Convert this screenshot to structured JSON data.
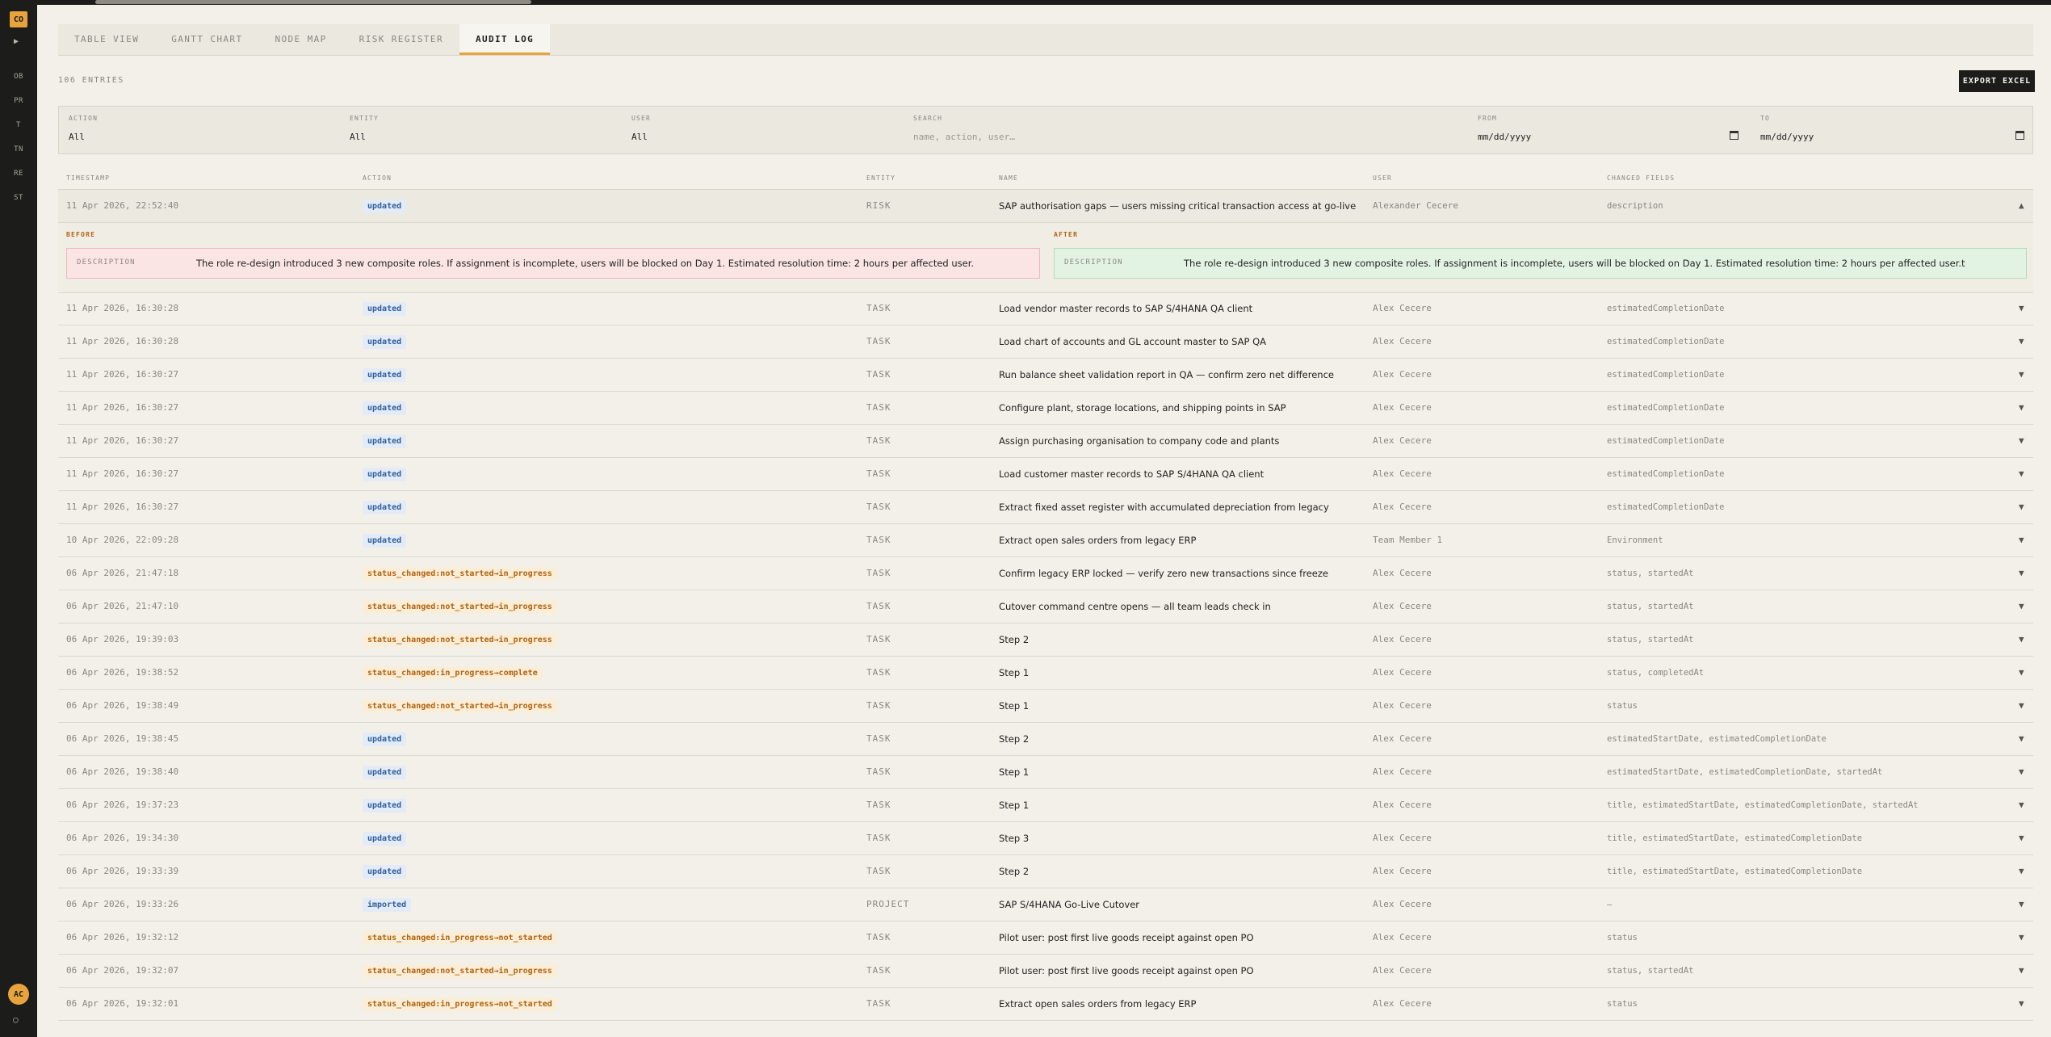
{
  "sidebar": {
    "logo": "CO",
    "items": [
      "OB",
      "PR",
      "T",
      "TN",
      "RE",
      "ST"
    ],
    "avatar": "AC"
  },
  "tabs": [
    "TABLE VIEW",
    "GANTT CHART",
    "NODE MAP",
    "RISK REGISTER",
    "AUDIT LOG"
  ],
  "active_tab": "AUDIT LOG",
  "entries_count": "106 ENTRIES",
  "export_label": "EXPORT EXCEL",
  "filters": {
    "action": {
      "label": "ACTION",
      "value": "All"
    },
    "entity": {
      "label": "ENTITY",
      "value": "All"
    },
    "user": {
      "label": "USER",
      "value": "All"
    },
    "search": {
      "label": "SEARCH",
      "placeholder": "name, action, user…"
    },
    "from": {
      "label": "FROM",
      "placeholder": "mm/dd/yyyy"
    },
    "to": {
      "label": "TO",
      "placeholder": "mm/dd/yyyy"
    }
  },
  "columns": [
    "TIMESTAMP",
    "ACTION",
    "ENTITY",
    "NAME",
    "USER",
    "CHANGED FIELDS"
  ],
  "expanded_row": {
    "timestamp": "11 Apr 2026, 22:52:40",
    "action": "updated",
    "entity": "RISK",
    "name": "SAP authorisation gaps — users missing critical transaction access at go-live",
    "user": "Alexander Cecere",
    "fields": "description",
    "before_title": "BEFORE",
    "after_title": "AFTER",
    "field_label": "DESCRIPTION",
    "before_text": "The role re-design introduced 3 new composite roles. If assignment is incomplete, users will be blocked on Day 1. Estimated resolution time: 2 hours per affected user.",
    "after_text": "The role re-design introduced 3 new composite roles. If assignment is incomplete, users will be blocked on Day 1. Estimated resolution time: 2 hours per affected user.t",
    "chevron": "▲"
  },
  "rows": [
    {
      "timestamp": "11 Apr 2026, 16:30:28",
      "action": "updated",
      "kind": "updated",
      "entity": "TASK",
      "name": "Load vendor master records to SAP S/4HANA QA client",
      "user": "Alex Cecere",
      "fields": "estimatedCompletionDate"
    },
    {
      "timestamp": "11 Apr 2026, 16:30:28",
      "action": "updated",
      "kind": "updated",
      "entity": "TASK",
      "name": "Load chart of accounts and GL account master to SAP QA",
      "user": "Alex Cecere",
      "fields": "estimatedCompletionDate"
    },
    {
      "timestamp": "11 Apr 2026, 16:30:27",
      "action": "updated",
      "kind": "updated",
      "entity": "TASK",
      "name": "Run balance sheet validation report in QA — confirm zero net difference",
      "user": "Alex Cecere",
      "fields": "estimatedCompletionDate"
    },
    {
      "timestamp": "11 Apr 2026, 16:30:27",
      "action": "updated",
      "kind": "updated",
      "entity": "TASK",
      "name": "Configure plant, storage locations, and shipping points in SAP",
      "user": "Alex Cecere",
      "fields": "estimatedCompletionDate"
    },
    {
      "timestamp": "11 Apr 2026, 16:30:27",
      "action": "updated",
      "kind": "updated",
      "entity": "TASK",
      "name": "Assign purchasing organisation to company code and plants",
      "user": "Alex Cecere",
      "fields": "estimatedCompletionDate"
    },
    {
      "timestamp": "11 Apr 2026, 16:30:27",
      "action": "updated",
      "kind": "updated",
      "entity": "TASK",
      "name": "Load customer master records to SAP S/4HANA QA client",
      "user": "Alex Cecere",
      "fields": "estimatedCompletionDate"
    },
    {
      "timestamp": "11 Apr 2026, 16:30:27",
      "action": "updated",
      "kind": "updated",
      "entity": "TASK",
      "name": "Extract fixed asset register with accumulated depreciation from legacy",
      "user": "Alex Cecere",
      "fields": "estimatedCompletionDate"
    },
    {
      "timestamp": "10 Apr 2026, 22:09:28",
      "action": "updated",
      "kind": "updated",
      "entity": "TASK",
      "name": "Extract open sales orders from legacy ERP",
      "user": "Team Member 1",
      "fields": "Environment"
    },
    {
      "timestamp": "06 Apr 2026, 21:47:18",
      "action": "status_changed:not_started→in_progress",
      "kind": "status",
      "entity": "TASK",
      "name": "Confirm legacy ERP locked — verify zero new transactions since freeze",
      "user": "Alex Cecere",
      "fields": "status, startedAt"
    },
    {
      "timestamp": "06 Apr 2026, 21:47:10",
      "action": "status_changed:not_started→in_progress",
      "kind": "status",
      "entity": "TASK",
      "name": "Cutover command centre opens — all team leads check in",
      "user": "Alex Cecere",
      "fields": "status, startedAt"
    },
    {
      "timestamp": "06 Apr 2026, 19:39:03",
      "action": "status_changed:not_started→in_progress",
      "kind": "status",
      "entity": "TASK",
      "name": "Step 2",
      "user": "Alex Cecere",
      "fields": "status, startedAt"
    },
    {
      "timestamp": "06 Apr 2026, 19:38:52",
      "action": "status_changed:in_progress→complete",
      "kind": "status",
      "entity": "TASK",
      "name": "Step 1",
      "user": "Alex Cecere",
      "fields": "status, completedAt"
    },
    {
      "timestamp": "06 Apr 2026, 19:38:49",
      "action": "status_changed:not_started→in_progress",
      "kind": "status",
      "entity": "TASK",
      "name": "Step 1",
      "user": "Alex Cecere",
      "fields": "status"
    },
    {
      "timestamp": "06 Apr 2026, 19:38:45",
      "action": "updated",
      "kind": "updated",
      "entity": "TASK",
      "name": "Step 2",
      "user": "Alex Cecere",
      "fields": "estimatedStartDate, estimatedCompletionDate"
    },
    {
      "timestamp": "06 Apr 2026, 19:38:40",
      "action": "updated",
      "kind": "updated",
      "entity": "TASK",
      "name": "Step 1",
      "user": "Alex Cecere",
      "fields": "estimatedStartDate, estimatedCompletionDate, startedAt"
    },
    {
      "timestamp": "06 Apr 2026, 19:37:23",
      "action": "updated",
      "kind": "updated",
      "entity": "TASK",
      "name": "Step 1",
      "user": "Alex Cecere",
      "fields": "title, estimatedStartDate, estimatedCompletionDate, startedAt"
    },
    {
      "timestamp": "06 Apr 2026, 19:34:30",
      "action": "updated",
      "kind": "updated",
      "entity": "TASK",
      "name": "Step 3",
      "user": "Alex Cecere",
      "fields": "title, estimatedStartDate, estimatedCompletionDate"
    },
    {
      "timestamp": "06 Apr 2026, 19:33:39",
      "action": "updated",
      "kind": "updated",
      "entity": "TASK",
      "name": "Step 2",
      "user": "Alex Cecere",
      "fields": "title, estimatedStartDate, estimatedCompletionDate"
    },
    {
      "timestamp": "06 Apr 2026, 19:33:26",
      "action": "imported",
      "kind": "imported",
      "entity": "PROJECT",
      "name": "SAP S/4HANA Go-Live Cutover",
      "user": "Alex Cecere",
      "fields": "—"
    },
    {
      "timestamp": "06 Apr 2026, 19:32:12",
      "action": "status_changed:in_progress→not_started",
      "kind": "status",
      "entity": "TASK",
      "name": "Pilot user: post first live goods receipt against open PO",
      "user": "Alex Cecere",
      "fields": "status"
    },
    {
      "timestamp": "06 Apr 2026, 19:32:07",
      "action": "status_changed:not_started→in_progress",
      "kind": "status",
      "entity": "TASK",
      "name": "Pilot user: post first live goods receipt against open PO",
      "user": "Alex Cecere",
      "fields": "status, startedAt"
    },
    {
      "timestamp": "06 Apr 2026, 19:32:01",
      "action": "status_changed:in_progress→not_started",
      "kind": "status",
      "entity": "TASK",
      "name": "Extract open sales orders from legacy ERP",
      "user": "Alex Cecere",
      "fields": "status"
    }
  ],
  "chevron_collapsed": "▼"
}
